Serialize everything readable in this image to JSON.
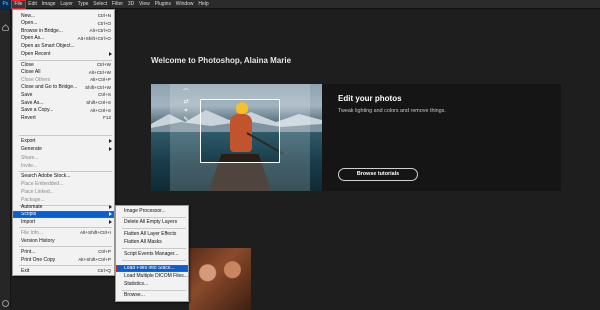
{
  "app": {
    "logo": "Ps"
  },
  "menubar": [
    "File",
    "Edit",
    "Image",
    "Layer",
    "Type",
    "Select",
    "Filter",
    "3D",
    "View",
    "Plugins",
    "Window",
    "Help"
  ],
  "home": {
    "welcome": "Welcome to Photoshop, Alaina Marie",
    "card_title": "Edit your photos",
    "card_desc": "Tweak lighting and colors and remove things.",
    "tutorial_button": "Browse tutorials"
  },
  "file_menu": [
    {
      "label": "New...",
      "shortcut": "Ctrl+N"
    },
    {
      "label": "Open...",
      "shortcut": "Ctrl+O"
    },
    {
      "label": "Browse in Bridge...",
      "shortcut": "Alt+Ctrl+O"
    },
    {
      "label": "Open As...",
      "shortcut": "Alt+Shift+Ctrl+O"
    },
    {
      "label": "Open as Smart Object...",
      "shortcut": ""
    },
    {
      "label": "Open Recent",
      "shortcut": "",
      "submenu": true
    },
    {
      "label": "Close",
      "shortcut": "Ctrl+W"
    },
    {
      "label": "Close All",
      "shortcut": "Alt+Ctrl+W"
    },
    {
      "label": "Close Others",
      "shortcut": "Alt+Ctrl+P",
      "disabled": true
    },
    {
      "label": "Close and Go to Bridge...",
      "shortcut": "Shift+Ctrl+W"
    },
    {
      "label": "Save",
      "shortcut": "Ctrl+S"
    },
    {
      "label": "Save As...",
      "shortcut": "Shift+Ctrl+S"
    },
    {
      "label": "Save a Copy...",
      "shortcut": "Alt+Ctrl+S"
    },
    {
      "label": "Revert",
      "shortcut": "F12"
    },
    {
      "label": "Export",
      "shortcut": "",
      "submenu": true
    },
    {
      "label": "Generate",
      "shortcut": "",
      "submenu": true
    },
    {
      "label": "Share...",
      "shortcut": "",
      "disabled": true
    },
    {
      "label": "Invite...",
      "shortcut": "",
      "disabled": true
    },
    {
      "label": "Search Adobe Stock...",
      "shortcut": ""
    },
    {
      "label": "Place Embedded...",
      "shortcut": "",
      "disabled": true
    },
    {
      "label": "Place Linked...",
      "shortcut": "",
      "disabled": true
    },
    {
      "label": "Package...",
      "shortcut": "",
      "disabled": true
    },
    {
      "label": "Automate",
      "shortcut": "",
      "submenu": true
    },
    {
      "label": "Scripts",
      "shortcut": "",
      "submenu": true,
      "highlighted": true
    },
    {
      "label": "Import",
      "shortcut": "",
      "submenu": true
    },
    {
      "label": "File Info...",
      "shortcut": "Alt+Shift+Ctrl+I",
      "disabled": true
    },
    {
      "label": "Version History",
      "shortcut": ""
    },
    {
      "label": "Print...",
      "shortcut": "Ctrl+P"
    },
    {
      "label": "Print One Copy",
      "shortcut": "Alt+Shift+Ctrl+P"
    },
    {
      "label": "Exit",
      "shortcut": "Ctrl+Q"
    }
  ],
  "scripts_menu": [
    {
      "label": "Image Processor..."
    },
    {
      "label": "Delete All Empty Layers"
    },
    {
      "label": "Flatten All Layer Effects"
    },
    {
      "label": "Flatten All Masks"
    },
    {
      "label": "Script Events Manager..."
    },
    {
      "label": "Load Files into Stack...",
      "highlighted": true
    },
    {
      "label": "Load Multiple DICOM Files..."
    },
    {
      "label": "Statistics..."
    },
    {
      "label": "Browse..."
    }
  ],
  "colors": {
    "accent": "#0a5fd0",
    "highlight_border": "#e0232e",
    "brand": "#31a8ff"
  }
}
